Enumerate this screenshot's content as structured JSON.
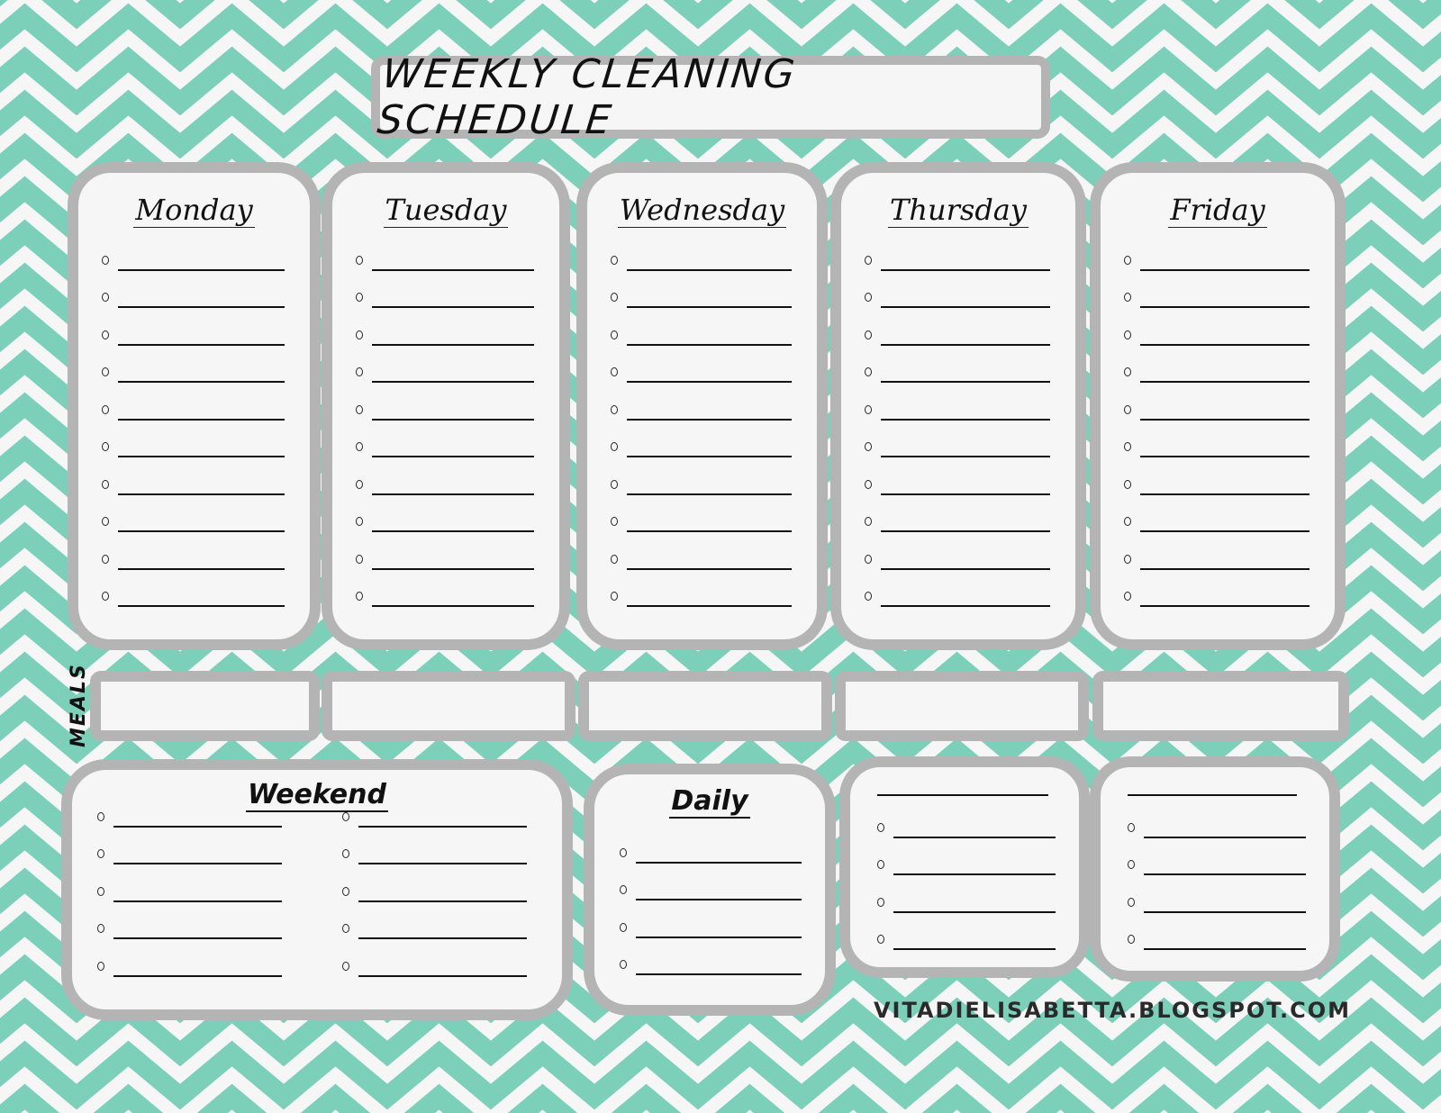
{
  "title": "WEEKLY CLEANING SCHEDULE",
  "colors": {
    "chevron": "#7ccfb9",
    "background": "#f6f6f6",
    "box_border": "#b4b4b4",
    "text": "#111111"
  },
  "days": [
    {
      "name": "Monday",
      "items": [
        "",
        "",
        "",
        "",
        "",
        "",
        "",
        "",
        "",
        ""
      ]
    },
    {
      "name": "Tuesday",
      "items": [
        "",
        "",
        "",
        "",
        "",
        "",
        "",
        "",
        "",
        ""
      ]
    },
    {
      "name": "Wednesday",
      "items": [
        "",
        "",
        "",
        "",
        "",
        "",
        "",
        "",
        "",
        ""
      ]
    },
    {
      "name": "Thursday",
      "items": [
        "",
        "",
        "",
        "",
        "",
        "",
        "",
        "",
        "",
        ""
      ]
    },
    {
      "name": "Friday",
      "items": [
        "",
        "",
        "",
        "",
        "",
        "",
        "",
        "",
        "",
        ""
      ]
    }
  ],
  "meals": {
    "label": "MEALS",
    "entries": [
      "",
      "",
      "",
      "",
      ""
    ]
  },
  "weekend": {
    "title": "Weekend",
    "left_items": [
      "",
      "",
      "",
      "",
      ""
    ],
    "right_items": [
      "",
      "",
      "",
      "",
      ""
    ]
  },
  "daily": {
    "title": "Daily",
    "items": [
      "",
      "",
      "",
      ""
    ]
  },
  "custom_lists": [
    {
      "title": "",
      "items": [
        "",
        "",
        "",
        ""
      ]
    },
    {
      "title": "",
      "items": [
        "",
        "",
        "",
        ""
      ]
    }
  ],
  "footer": "VITADIELISABETTA.BLOGSPOT.COM"
}
